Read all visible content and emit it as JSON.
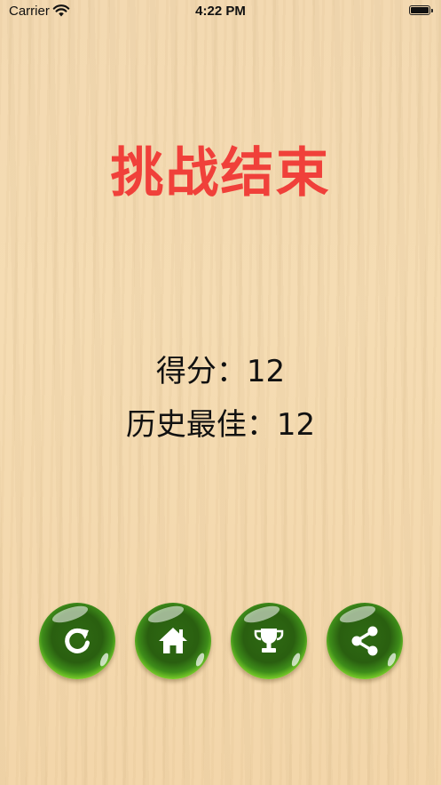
{
  "status_bar": {
    "carrier": "Carrier",
    "time": "4:22 PM",
    "wifi_icon": "wifi-icon",
    "battery_icon": "battery-icon"
  },
  "title": "挑战结束",
  "score": {
    "current": "得分：12",
    "best": "历史最佳：12"
  },
  "buttons": [
    {
      "icon": "restart-icon"
    },
    {
      "icon": "home-icon"
    },
    {
      "icon": "trophy-icon"
    },
    {
      "icon": "share-icon"
    }
  ],
  "colors": {
    "title": "#f0403a",
    "button_green": "#7bcf2a",
    "button_dark": "#2a5f10",
    "background": "#f4d9ae"
  }
}
